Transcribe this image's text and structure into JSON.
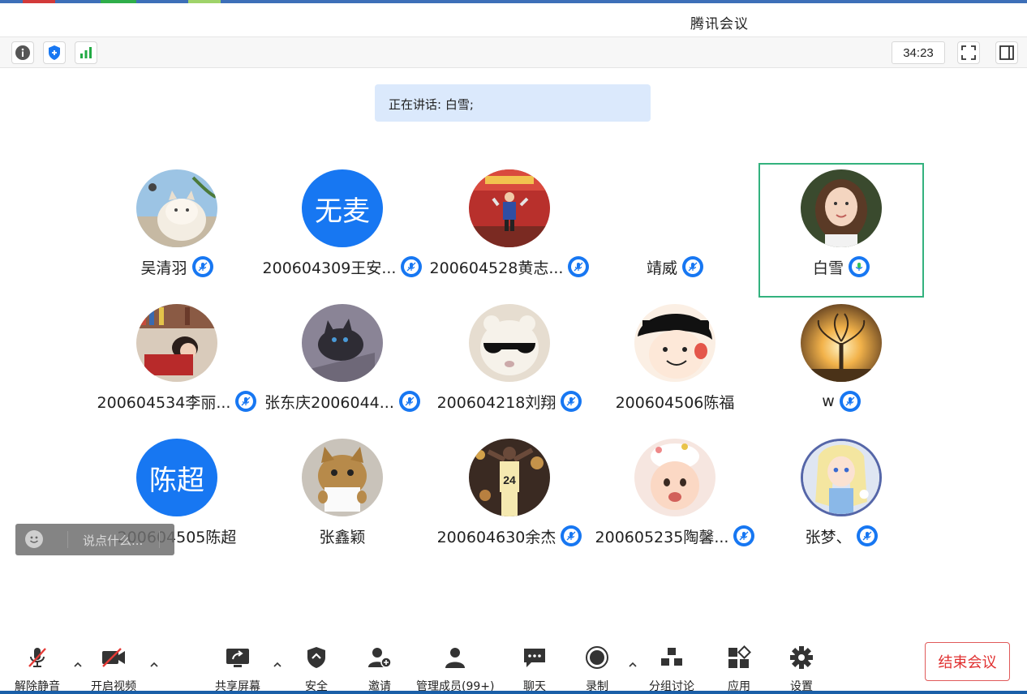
{
  "window": {
    "title": "腾讯会议"
  },
  "toolrow": {
    "timer": "34:23"
  },
  "banner": {
    "speaking": "正在讲话: 白雪;"
  },
  "colors": {
    "accent": "#1777f2",
    "active_border": "#33b27e",
    "end_red": "#e03030",
    "speaking_bg": "#dbe9fc"
  },
  "participants": [
    {
      "name": "吴清羽",
      "avatar": "cat-photo",
      "mic": "muted"
    },
    {
      "name": "200604309王安...",
      "avatar_text": "无麦",
      "mic": "muted"
    },
    {
      "name": "200604528黄志...",
      "avatar": "runner-photo",
      "mic": "muted"
    },
    {
      "name": "靖威",
      "avatar": "none",
      "mic": "muted"
    },
    {
      "name": "白雪",
      "avatar": "girl-photo",
      "mic": "speaking",
      "active": true
    },
    {
      "name": "200604534李丽...",
      "avatar": "reading-photo",
      "mic": "muted"
    },
    {
      "name": "张东庆2006044...",
      "avatar": "cat-cartoon",
      "mic": "muted"
    },
    {
      "name": "200604218刘翔",
      "avatar": "sunglasses-toy",
      "mic": "muted"
    },
    {
      "name": "200604506陈福",
      "avatar": "cartoon-face",
      "mic": "none"
    },
    {
      "name": "w",
      "avatar": "tree-sunset",
      "mic": "muted"
    },
    {
      "name": "200604505陈超",
      "avatar_text": "陈超",
      "mic": "none"
    },
    {
      "name": "张鑫颖",
      "avatar": "cat-sign",
      "mic": "none"
    },
    {
      "name": "200604630余杰",
      "avatar": "basketball-24",
      "mic": "muted"
    },
    {
      "name": "200605235陶馨...",
      "avatar": "baby-photo",
      "mic": "muted"
    },
    {
      "name": "张梦、",
      "avatar": "princess-cartoon",
      "mic": "muted"
    }
  ],
  "chat": {
    "placeholder": "说点什么..."
  },
  "toolbar": {
    "unmute": "解除静音",
    "video": "开启视频",
    "share": "共享屏幕",
    "security": "安全",
    "invite": "邀请",
    "members": "管理成员(99+)",
    "chat": "聊天",
    "record": "录制",
    "breakout": "分组讨论",
    "apps": "应用",
    "settings": "设置",
    "end": "结束会议"
  }
}
